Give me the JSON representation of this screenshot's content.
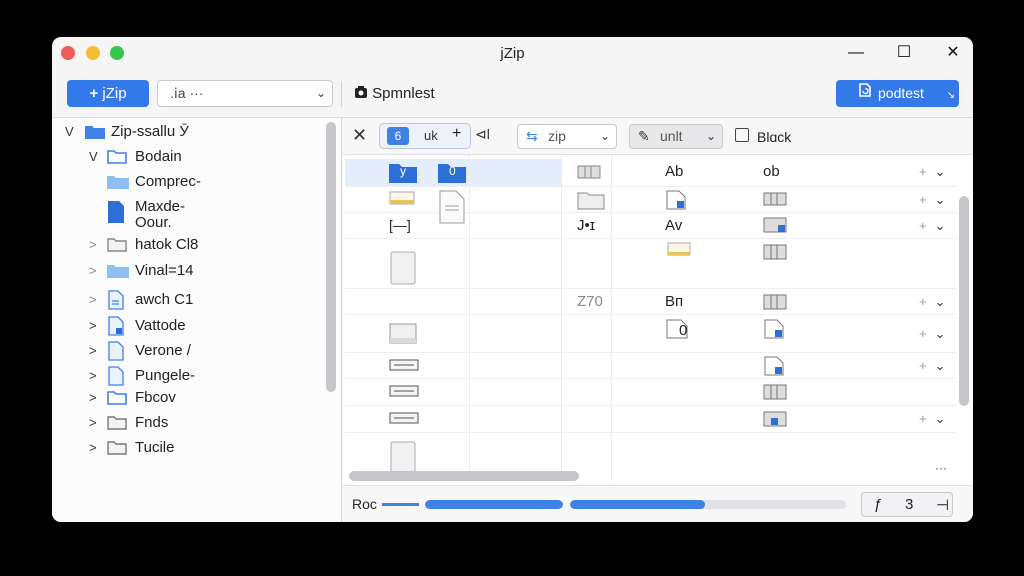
{
  "window": {
    "title": "jZip",
    "minimize": "—",
    "maximize": "☐",
    "close": "✕"
  },
  "toolbar": {
    "primary_button": "jZip",
    "primary_icon": "+",
    "dropdown_value": ".ⅰa ···",
    "label": "Spmnlest",
    "right_button": "podtest"
  },
  "sidebar": {
    "items": [
      {
        "label": "Zip-ssallu Ӯ",
        "arrow": "V",
        "icon": "folder-filled-icon"
      },
      {
        "label": "Bodain",
        "arrow": "V",
        "icon": "folder-outline-icon"
      },
      {
        "label": "Comprec-",
        "arrow": "",
        "icon": "folder-light-icon"
      },
      {
        "label": "Maxde-",
        "label2": "Oour.",
        "arrow": "",
        "icon": "document-icon"
      },
      {
        "label": "hatok Cl8",
        "arrow": ">",
        "icon": "folder-gray-icon"
      },
      {
        "label": "Vinal=14",
        "arrow": ">",
        "icon": "folder-light-icon"
      },
      {
        "label": "awch C1",
        "arrow": ">",
        "icon": "file-icon"
      },
      {
        "label": "Vattode",
        "arrow": ">",
        "icon": "file-icon"
      },
      {
        "label": "Verone /",
        "arrow": ">",
        "icon": "file-icon"
      },
      {
        "label": "Pungele-",
        "arrow": ">",
        "icon": "file-icon"
      },
      {
        "label": "Fbcov",
        "arrow": ">",
        "icon": "folder-outline-icon"
      },
      {
        "label": "Fnds",
        "arrow": ">",
        "icon": "folder-gray-icon"
      },
      {
        "label": "Tucile",
        "arrow": ">",
        "icon": "folder-gray-icon"
      }
    ]
  },
  "main_toolbar": {
    "seg_active": "6",
    "seg_label": "uk",
    "seg_plus": "+",
    "seg_extra": "⊲l",
    "zip_dropdown": "zip",
    "unit_dropdown": "unlt",
    "black_label": "Blɑck"
  },
  "grid": {
    "rows": [
      {
        "c1": "y",
        "c2": "0",
        "c4": "",
        "c5": "Ab",
        "c6": "ob",
        "controls": true
      },
      {
        "c1": "",
        "c2": "",
        "c4": "",
        "c5": "",
        "c6": "",
        "controls": true
      },
      {
        "c1": "[—]",
        "c2": "",
        "c4": "J•ɪ",
        "c5": "Av",
        "c6": "",
        "controls": true
      },
      {
        "c1": "",
        "c2": "",
        "c4": "",
        "c5": "",
        "c6": "",
        "controls": false
      },
      {
        "c1": "",
        "c2": "",
        "c4": "Z70",
        "c5": "Bп",
        "c6": "",
        "controls": true
      },
      {
        "c1": "",
        "c2": "",
        "c4": "",
        "c5": "0",
        "c6": "",
        "controls": true
      },
      {
        "c1": "",
        "c2": "",
        "c4": "",
        "c5": "",
        "c6": "",
        "controls": true
      },
      {
        "c1": "",
        "c2": "",
        "c4": "",
        "c5": "",
        "c6": "",
        "controls": false
      },
      {
        "c1": "",
        "c2": "",
        "c4": "",
        "c5": "",
        "c6": "",
        "controls": true
      }
    ],
    "more": "···"
  },
  "statusbar": {
    "label": "Roc",
    "progress1": 1.0,
    "progress2": 0.49,
    "pager_prev": "ƒ",
    "pager_num": "3",
    "pager_next": "⊣"
  },
  "colors": {
    "accent": "#3479e9",
    "folder": "#3f82e6"
  }
}
